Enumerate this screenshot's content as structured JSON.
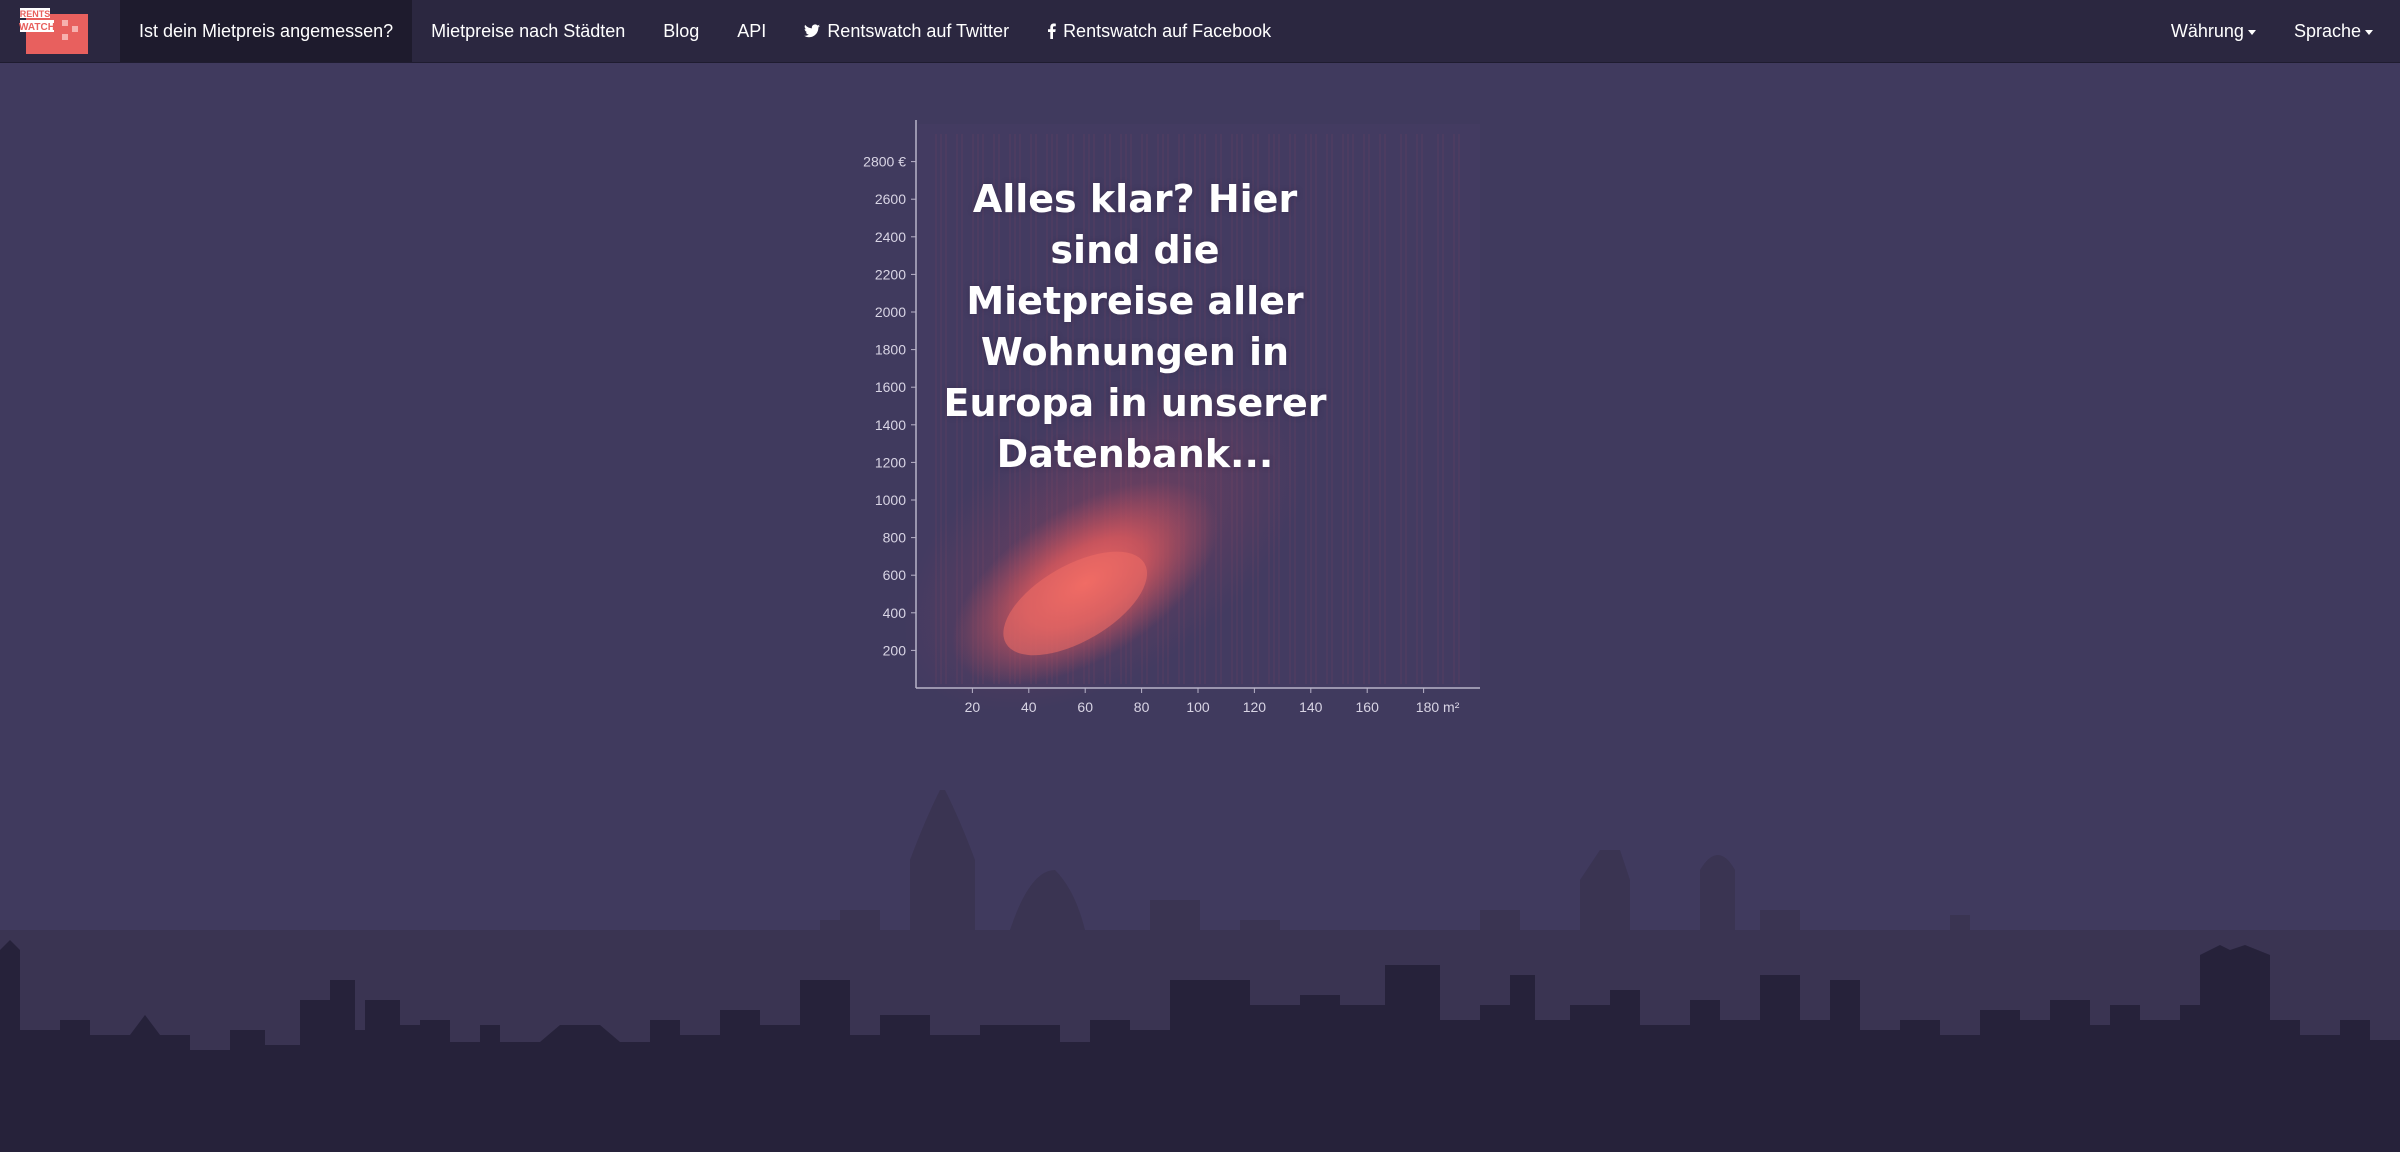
{
  "brand": {
    "logo_text_top": "RENTS",
    "logo_text_bottom": "WATCH"
  },
  "nav": {
    "items": [
      {
        "label": "Ist dein Mietpreis angemessen?",
        "active": true
      },
      {
        "label": "Mietpreise nach Städten"
      },
      {
        "label": "Blog"
      },
      {
        "label": "API"
      },
      {
        "label": "Rentswatch auf Twitter",
        "icon": "twitter-icon"
      },
      {
        "label": "Rentswatch auf Facebook",
        "icon": "facebook-icon"
      }
    ],
    "right": [
      {
        "label": "Währung"
      },
      {
        "label": "Sprache"
      }
    ]
  },
  "headline": "Alles klar? Hier sind die Mietpreise aller Wohnungen in Europa in unserer Datenbank...",
  "colors": {
    "background": "#403a5e",
    "navbar": "#2b2740",
    "accent": "#e8605e",
    "skyline_far": "#3a3452",
    "skyline_near": "#26223a"
  },
  "chart_data": {
    "type": "scatter",
    "title": "",
    "xlabel": "m²",
    "ylabel": "€",
    "xlim": [
      0,
      200
    ],
    "ylim": [
      0,
      3000
    ],
    "x_ticks": [
      20,
      40,
      60,
      80,
      100,
      120,
      140,
      160,
      180
    ],
    "y_ticks": [
      200,
      400,
      600,
      800,
      1000,
      1200,
      1400,
      1600,
      1800,
      2000,
      2200,
      2400,
      2600,
      2800
    ],
    "y_tick_labels": [
      "200",
      "400",
      "600",
      "800",
      "1000",
      "1200",
      "1400",
      "1600",
      "1800",
      "2000",
      "2200",
      "2400",
      "2600",
      "2800 €"
    ],
    "x_tick_labels": [
      "20",
      "40",
      "60",
      "80",
      "100",
      "120",
      "140",
      "160",
      "180 m²"
    ],
    "density_center": {
      "x": 60,
      "y": 450
    },
    "grid": false
  }
}
